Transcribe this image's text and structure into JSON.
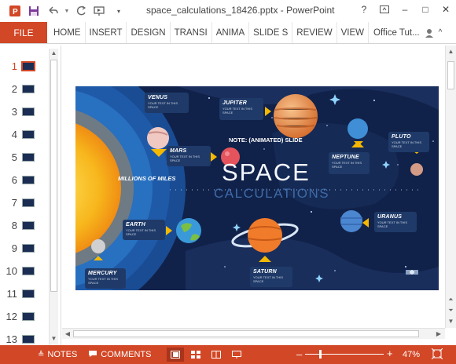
{
  "window": {
    "title": "space_calculations_18426.pptx - PowerPoint",
    "help_label": "?",
    "restore_icon": "ribbon-display-icon",
    "minimize_label": "–",
    "maximize_label": "□",
    "close_label": "✕"
  },
  "quick_access": {
    "app_icon": "powerpoint-icon",
    "save_icon": "save-icon",
    "undo_icon": "undo-icon",
    "redo_icon": "redo-icon",
    "present_icon": "present-from-beginning-icon",
    "customize_icon": "customize-qat-icon"
  },
  "ribbon": {
    "file_label": "FILE",
    "tabs": [
      "HOME",
      "INSERT",
      "DESIGN",
      "TRANSI",
      "ANIMA",
      "SLIDE S",
      "REVIEW",
      "VIEW"
    ],
    "account_label": "Office Tut...",
    "collapse_label": "^"
  },
  "thumbnails": {
    "slides": [
      "1",
      "2",
      "3",
      "4",
      "5",
      "6",
      "7",
      "8",
      "9",
      "10",
      "11",
      "12",
      "13"
    ],
    "active_index": 0
  },
  "slide": {
    "title_main": "SPACE",
    "title_sub": "CALCULATIONS",
    "note": "NOTE: (ANIMATED) SLIDE",
    "scale_label": "MILLIONS OF MILES",
    "placeholder": "YOUR TEXT IN THIS SPACE",
    "planets": {
      "venus": "VENUS",
      "jupiter": "JUPITER",
      "mars": "MARS",
      "neptune": "NEPTUNE",
      "pluto": "PLUTO",
      "earth": "EARTH",
      "uranus": "URANUS",
      "mercury": "MERCURY",
      "saturn": "SATURN"
    },
    "colors": {
      "sun": "#f7b51b",
      "space": "#11224a",
      "label_box": "#1f3a68",
      "arrow": "#f5b800"
    }
  },
  "status": {
    "notes_label": "NOTES",
    "comments_label": "COMMENTS",
    "zoom_minus": "–",
    "zoom_plus": "+",
    "zoom_level": "47%",
    "accent": "#d24726"
  }
}
